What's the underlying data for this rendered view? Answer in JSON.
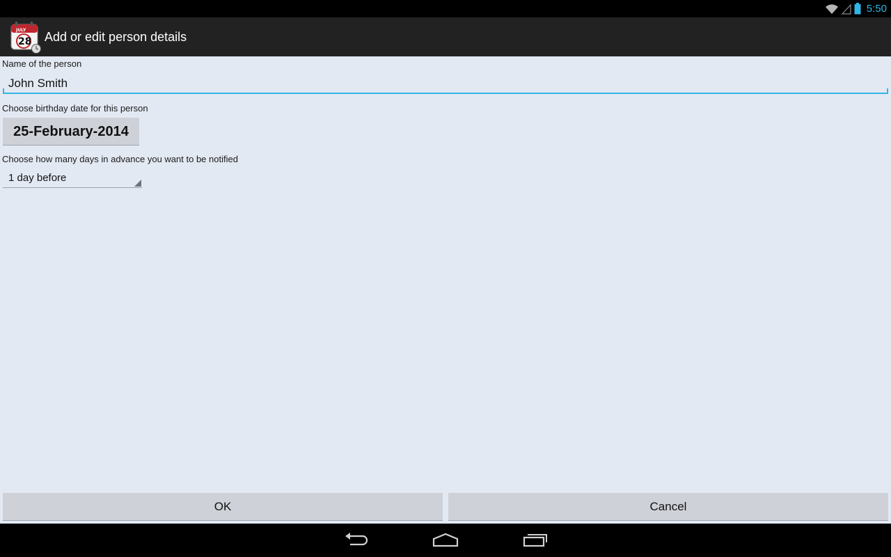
{
  "status_bar": {
    "time": "5:50",
    "icons": [
      "wifi-icon",
      "signal-icon",
      "battery-icon"
    ],
    "accent_color": "#33b5e5"
  },
  "action_bar": {
    "app_icon": "calendar-icon",
    "title": "Add or edit person details"
  },
  "form": {
    "name_label": "Name of the person",
    "name_value": "John Smith",
    "birthday_label": "Choose birthday date for this person",
    "birthday_value": "25-February-2014",
    "advance_label": "Choose how many days in advance you want to be notified",
    "advance_value": "1 day before"
  },
  "buttons": {
    "ok": "OK",
    "cancel": "Cancel"
  },
  "nav_bar": {
    "icons": [
      "back-icon",
      "home-icon",
      "recent-apps-icon"
    ]
  },
  "colors": {
    "background": "#e3e9f3",
    "action_bar": "#222222",
    "button": "#cfd1d8",
    "focus": "#33b5e5"
  }
}
